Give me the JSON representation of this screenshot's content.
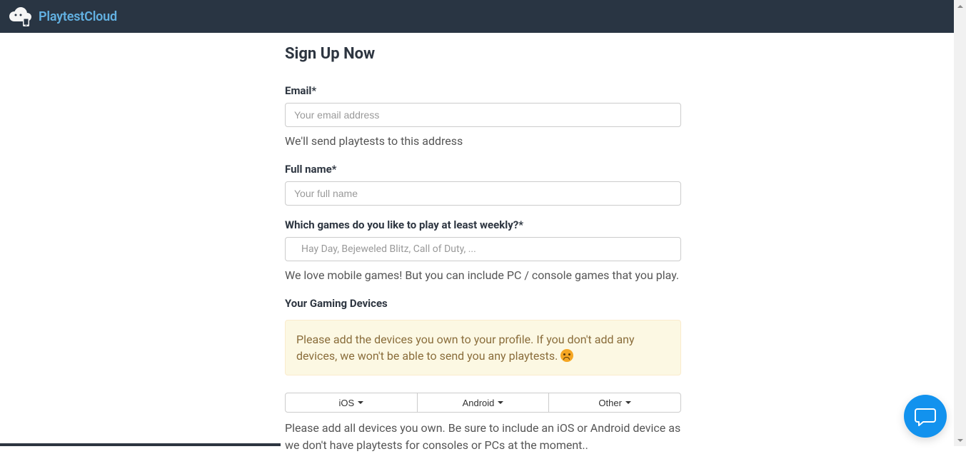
{
  "brand": "PlaytestCloud",
  "page_title": "Sign Up Now",
  "form": {
    "email": {
      "label": "Email*",
      "placeholder": "Your email address",
      "help": "We'll send playtests to this address"
    },
    "fullname": {
      "label": "Full name*",
      "placeholder": "Your full name"
    },
    "games": {
      "label": "Which games do you like to play at least weekly?*",
      "placeholder": "Hay Day, Bejeweled Blitz, Call of Duty, ...",
      "help": "We love mobile games! But you can include PC / console games that you play."
    },
    "devices": {
      "heading": "Your Gaming Devices",
      "warning": "Please add the devices you own to your profile. If you don't add any devices, we won't be able to send you any playtests. ",
      "buttons": [
        "iOS",
        "Android",
        "Other"
      ],
      "help": "Please add all devices you own. Be sure to include an iOS or Android device as we don't have playtests for consoles or PCs at the moment.."
    }
  }
}
